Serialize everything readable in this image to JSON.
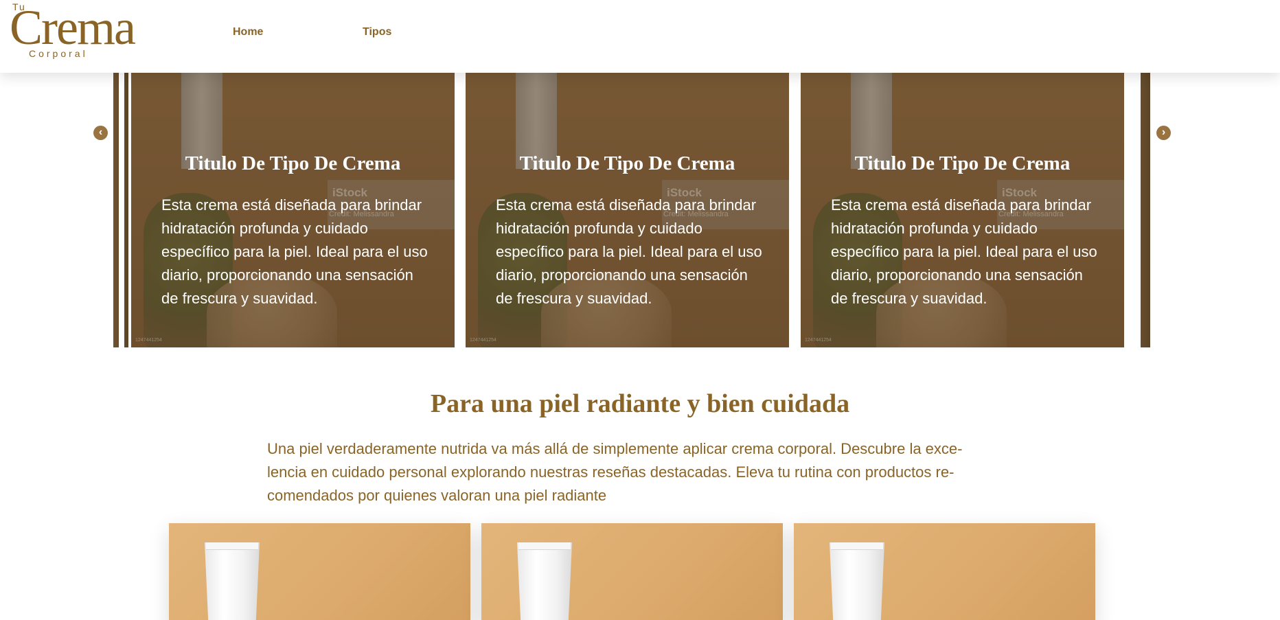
{
  "logo": {
    "top": "Tu",
    "main": "Crema",
    "bottom": "Corporal"
  },
  "nav": {
    "items": [
      {
        "label": "Home"
      },
      {
        "label": "Tipos"
      }
    ]
  },
  "carousel": {
    "prev_icon": "chevron-left-icon",
    "next_icon": "chevron-right-icon",
    "prev_glyph": "‹",
    "next_glyph": "›",
    "slides": [
      {
        "title": "Titulo De Tipo De Crema",
        "text": "Esta crema está diseñada para brindar hidratación profunda y cuidado específico para la piel. Ideal para el uso diario, proporcionando una sensación de frescura y suavidad.",
        "watermark": "iStock",
        "credit": "Credit: Melissandra",
        "image_id": "1247441254"
      },
      {
        "title": "Titulo De Tipo De Crema",
        "text": "Esta crema está diseñada para brindar hidratación profunda y cuidado específico para la piel. Ideal para el uso diario, proporcionando una sensación de frescura y suavidad.",
        "watermark": "iStock",
        "credit": "Credit: Melissandra",
        "image_id": "1247441254"
      },
      {
        "title": "Titulo De Tipo De Crema",
        "text": "Esta crema está diseñada para brindar hidratación profunda y cuidado específico para la piel. Ideal para el uso diario, proporcionando una sensación de frescura y suavidad.",
        "watermark": "iStock",
        "credit": "Credit: Melissandra",
        "image_id": "1247441254"
      }
    ]
  },
  "intro": {
    "title": "Para una piel radiante y bien cuidada",
    "text": "Una piel verdaderamente nutrida va más allá de simplemente aplicar crema corporal. Descubre la exce-lencia en cuidado personal explorando nuestras reseñas destacadas. Eleva tu rutina con productos re-comendados por quienes valoran una piel radiante"
  },
  "colors": {
    "brand": "#8a6427",
    "arrow": "#9a7440",
    "card_bg": "#e3b57a"
  }
}
